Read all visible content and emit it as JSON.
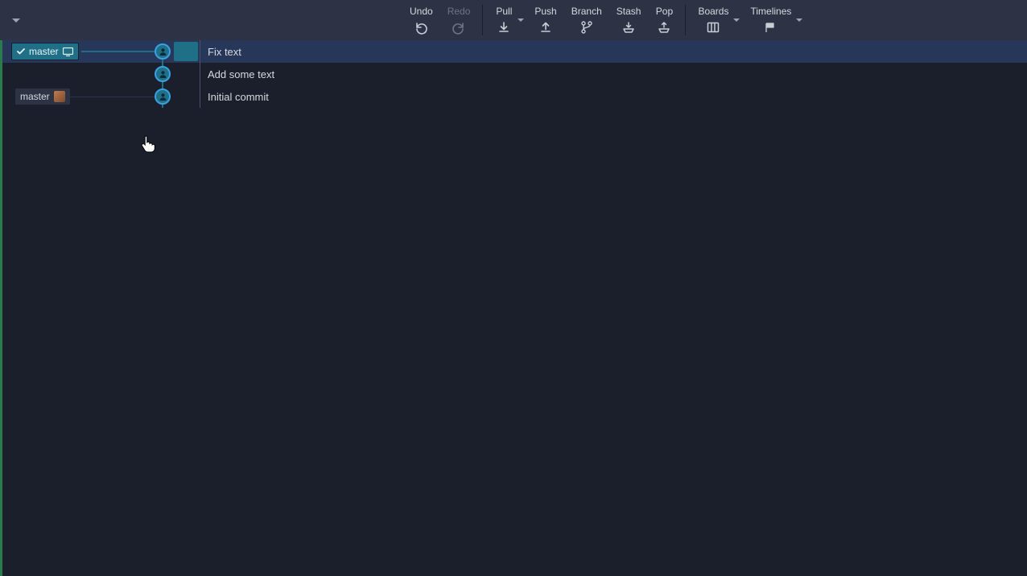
{
  "toolbar": {
    "undo": "Undo",
    "redo": "Redo",
    "pull": "Pull",
    "push": "Push",
    "branch": "Branch",
    "stash": "Stash",
    "pop": "Pop",
    "boards": "Boards",
    "timelines": "Timelines"
  },
  "branches": {
    "local_head": "master",
    "remote_ref": "master"
  },
  "commits": [
    {
      "message": "Fix text",
      "selected": true,
      "local_ref": true,
      "remote_ref": false
    },
    {
      "message": "Add some text",
      "selected": false,
      "local_ref": false,
      "remote_ref": false
    },
    {
      "message": "Initial commit",
      "selected": false,
      "local_ref": false,
      "remote_ref": true
    }
  ],
  "icons": {
    "avatar": "user-avatar"
  }
}
